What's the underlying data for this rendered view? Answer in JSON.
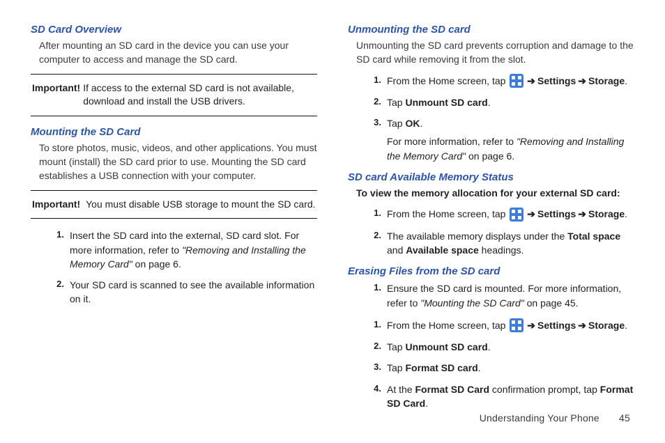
{
  "left": {
    "h1": "SD Card Overview",
    "p1": "After mounting an SD card in the device you can use your computer to access and manage the SD card.",
    "imp1_label": "Important!",
    "imp1_text": "If access to the external SD card is not available, download and install the USB drivers.",
    "h2": "Mounting the SD Card",
    "p2": "To store photos, music, videos, and other applications. You must mount (install) the SD card prior to use. Mounting the SD card establishes a USB connection with your computer.",
    "imp2_label": "Important!",
    "imp2_text": "You must disable USB storage to mount the SD card.",
    "s1_a": "Insert the SD card into the external, SD card slot. For more information, refer to ",
    "s1_b": "\"Removing and Installing the Memory Card\"",
    "s1_c": " on page 6.",
    "s2": "Your SD card is scanned to see the available information on it."
  },
  "right": {
    "h1": "Unmounting the SD card",
    "p1": "Unmounting the SD card prevents corruption and damage to the SD card while removing it from the slot.",
    "u1_a": "From the Home screen, tap ",
    "arrow": "➔",
    "settings": "Settings",
    "storage": "Storage",
    "period": ".",
    "u2_a": "Tap ",
    "u2_b": "Unmount SD card",
    "u3_a": "Tap ",
    "u3_b": "OK",
    "u3_note_a": "For more information, refer to ",
    "u3_note_b": "\"Removing and Installing the Memory Card\"",
    "u3_note_c": " on page 6.",
    "h2": "SD card Available Memory Status",
    "p2": "To view the memory allocation for your external SD card:",
    "m1_a": "From the Home screen, tap ",
    "m2_a": "The available memory displays under the ",
    "m2_b": "Total space",
    "m2_c": " and ",
    "m2_d": "Available space",
    "m2_e": " headings.",
    "h3": "Erasing Files from the SD card",
    "e1_a": "Ensure the SD card is mounted. For more information, refer to ",
    "e1_b": "\"Mounting the SD Card\"",
    "e1_c": " on page 45.",
    "e2_a": "From the Home screen, tap ",
    "e3_a": "Tap ",
    "e3_b": "Unmount SD card",
    "e4_a": "Tap ",
    "e4_b": "Format SD card",
    "e5_a": "At the ",
    "e5_b": "Format SD Card",
    "e5_c": " confirmation prompt, tap ",
    "e5_d": "Format SD Card"
  },
  "footer": {
    "section": "Understanding Your Phone",
    "page": "45"
  }
}
